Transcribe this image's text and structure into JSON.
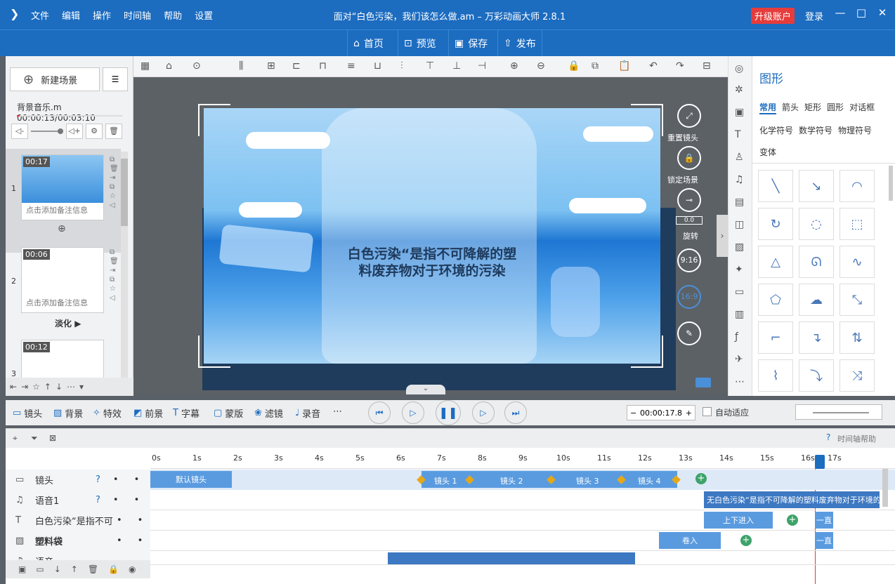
{
  "menu": [
    "文件",
    "编辑",
    "操作",
    "时间轴",
    "帮助",
    "设置"
  ],
  "title": "面对“白色污染，我们该怎么做.am – 万彩动画大师 2.8.1",
  "upgrade": "升级账户",
  "login": "登录",
  "nav": [
    "首页",
    "预览",
    "保存",
    "发布"
  ],
  "left": {
    "new_scene": "新建场景",
    "bg_music": "背景音乐.m   00:00:13/00:03:10",
    "scenes": [
      {
        "num": "1",
        "time": "00:17",
        "note": "点击添加备注信息"
      },
      {
        "num": "2",
        "time": "00:06",
        "note": "点击添加备注信息",
        "transition": "淡化"
      },
      {
        "num": "3",
        "time": "00:12"
      }
    ]
  },
  "stage": {
    "caption_line1": "白色污染“是指不可降解的塑",
    "caption_line2": "料废弃物对于环境的污染",
    "reset_camera": "重置镜头",
    "lock_scene": "锁定场景",
    "rotate_value": "0.0",
    "rotate": "旋转",
    "ratio_916": "9:16",
    "ratio_169": "16:9"
  },
  "right": {
    "title": "图形",
    "tabs": [
      "常用",
      "箭头",
      "矩形",
      "圆形",
      "对话框",
      "化学符号",
      "数学符号",
      "物理符号",
      "变体"
    ]
  },
  "tabs": [
    "镜头",
    "背景",
    "特效",
    "前景",
    "字幕",
    "蒙版",
    "滤镜",
    "录音"
  ],
  "timecode": "00:00:17.8",
  "auto_fit": "自动适应",
  "tl_help": "时间轴帮助",
  "ticks": [
    "0s",
    "1s",
    "2s",
    "3s",
    "4s",
    "5s",
    "6s",
    "7s",
    "8s",
    "9s",
    "10s",
    "11s",
    "12s",
    "13s",
    "14s",
    "15s",
    "16s",
    "17s"
  ],
  "tracks": [
    {
      "name": "镜头"
    },
    {
      "name": "语音1"
    },
    {
      "name": "白色污染“是指不可"
    },
    {
      "name": "塑料袋"
    },
    {
      "name": "语音"
    }
  ],
  "clips": {
    "default_cam": "默认镜头",
    "cam1": "镜头 1",
    "cam2": "镜头 2",
    "cam3": "镜头 3",
    "cam4": "镜头 4",
    "voice": "无白色污染“是指不可降解的塑料废弃物对于环境的污染 无",
    "updown": "上下进入",
    "always1": "一直",
    "rollin": "卷入",
    "always2": "一直"
  }
}
